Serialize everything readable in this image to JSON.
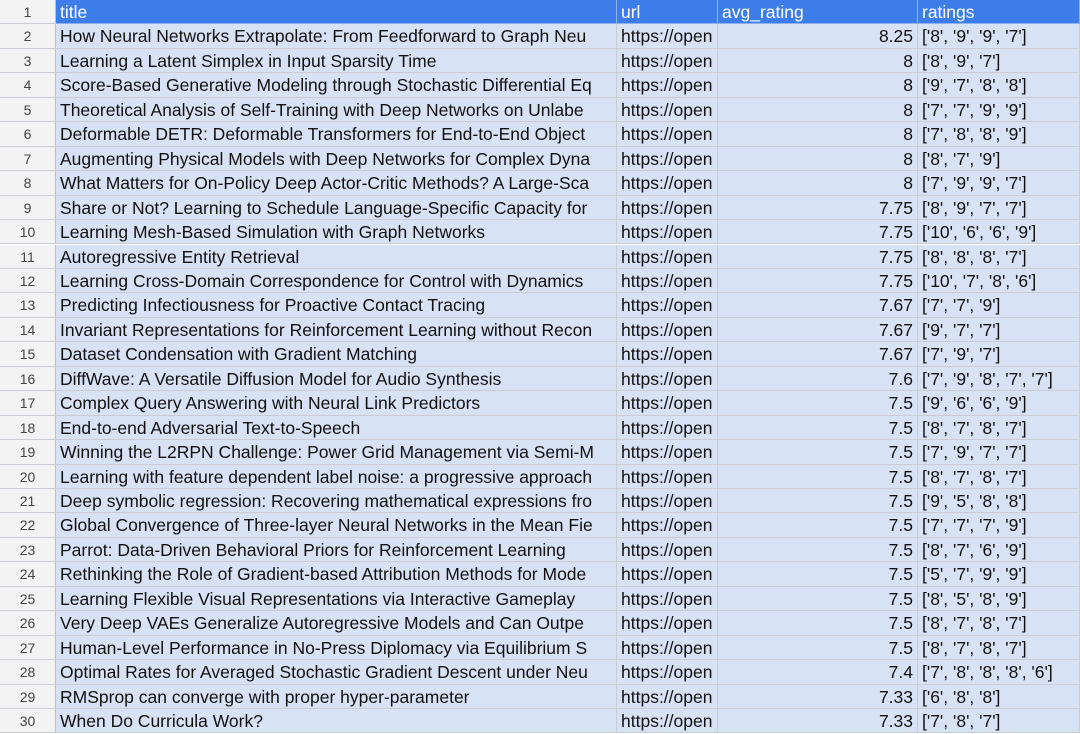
{
  "header": {
    "row_number": "1",
    "columns": [
      "title",
      "url",
      "avg_rating",
      "ratings"
    ]
  },
  "rows": [
    {
      "n": "2",
      "title": "How Neural Networks Extrapolate: From Feedforward to Graph Neu",
      "url": "https://open",
      "avg_rating": "8.25",
      "ratings": "['8', '9', '9', '7']"
    },
    {
      "n": "3",
      "title": "Learning a Latent Simplex in Input Sparsity Time",
      "url": "https://open",
      "avg_rating": "8",
      "ratings": "['8', '9', '7']"
    },
    {
      "n": "4",
      "title": "Score-Based Generative Modeling through Stochastic Differential Eq",
      "url": "https://open",
      "avg_rating": "8",
      "ratings": "['9', '7', '8', '8']"
    },
    {
      "n": "5",
      "title": "Theoretical Analysis of Self-Training with Deep Networks on Unlabe",
      "url": "https://open",
      "avg_rating": "8",
      "ratings": "['7', '7', '9', '9']"
    },
    {
      "n": "6",
      "title": "Deformable DETR: Deformable Transformers for End-to-End Object",
      "url": "https://open",
      "avg_rating": "8",
      "ratings": "['7', '8', '8', '9']"
    },
    {
      "n": "7",
      "title": "Augmenting Physical Models with Deep Networks for Complex Dyna",
      "url": "https://open",
      "avg_rating": "8",
      "ratings": "['8', '7', '9']"
    },
    {
      "n": "8",
      "title": "What Matters for On-Policy Deep Actor-Critic Methods? A Large-Sca",
      "url": "https://open",
      "avg_rating": "8",
      "ratings": "['7', '9', '9', '7']"
    },
    {
      "n": "9",
      "title": "Share or Not? Learning to Schedule Language-Specific Capacity for",
      "url": "https://open",
      "avg_rating": "7.75",
      "ratings": "['8', '9', '7', '7']"
    },
    {
      "n": "10",
      "title": "Learning Mesh-Based Simulation with Graph Networks",
      "url": "https://open",
      "avg_rating": "7.75",
      "ratings": "['10', '6', '6', '9']"
    },
    {
      "n": "11",
      "title": "Autoregressive Entity Retrieval",
      "url": "https://open",
      "avg_rating": "7.75",
      "ratings": "['8', '8', '8', '7']"
    },
    {
      "n": "12",
      "title": "Learning Cross-Domain Correspondence for Control with Dynamics",
      "url": "https://open",
      "avg_rating": "7.75",
      "ratings": "['10', '7', '8', '6']"
    },
    {
      "n": "13",
      "title": "Predicting Infectiousness for Proactive Contact Tracing",
      "url": "https://open",
      "avg_rating": "7.67",
      "ratings": "['7', '7', '9']"
    },
    {
      "n": "14",
      "title": "Invariant Representations for Reinforcement Learning without Recon",
      "url": "https://open",
      "avg_rating": "7.67",
      "ratings": "['9', '7', '7']"
    },
    {
      "n": "15",
      "title": "Dataset Condensation with Gradient Matching",
      "url": "https://open",
      "avg_rating": "7.67",
      "ratings": "['7', '9', '7']"
    },
    {
      "n": "16",
      "title": "DiffWave: A Versatile Diffusion Model for Audio Synthesis",
      "url": "https://open",
      "avg_rating": "7.6",
      "ratings": "['7', '9', '8', '7', '7']"
    },
    {
      "n": "17",
      "title": "Complex Query Answering with Neural Link Predictors",
      "url": "https://open",
      "avg_rating": "7.5",
      "ratings": "['9', '6', '6', '9']"
    },
    {
      "n": "18",
      "title": "End-to-end Adversarial Text-to-Speech",
      "url": "https://open",
      "avg_rating": "7.5",
      "ratings": "['8', '7', '8', '7']"
    },
    {
      "n": "19",
      "title": "Winning the L2RPN Challenge: Power Grid Management via Semi-M",
      "url": "https://open",
      "avg_rating": "7.5",
      "ratings": "['7', '9', '7', '7']"
    },
    {
      "n": "20",
      "title": "Learning with feature dependent label noise: a progressive approach",
      "url": "https://open",
      "avg_rating": "7.5",
      "ratings": "['8', '7', '8', '7']"
    },
    {
      "n": "21",
      "title": "Deep symbolic regression: Recovering mathematical expressions fro",
      "url": "https://open",
      "avg_rating": "7.5",
      "ratings": "['9', '5', '8', '8']"
    },
    {
      "n": "22",
      "title": "Global Convergence of Three-layer Neural Networks in the Mean Fie",
      "url": "https://open",
      "avg_rating": "7.5",
      "ratings": "['7', '7', '7', '9']"
    },
    {
      "n": "23",
      "title": "Parrot: Data-Driven Behavioral Priors for Reinforcement Learning",
      "url": "https://open",
      "avg_rating": "7.5",
      "ratings": "['8', '7', '6', '9']"
    },
    {
      "n": "24",
      "title": "Rethinking the Role of Gradient-based Attribution Methods for Mode",
      "url": "https://open",
      "avg_rating": "7.5",
      "ratings": "['5', '7', '9', '9']"
    },
    {
      "n": "25",
      "title": "Learning Flexible Visual Representations via Interactive Gameplay",
      "url": "https://open",
      "avg_rating": "7.5",
      "ratings": "['8', '5', '8', '9']"
    },
    {
      "n": "26",
      "title": "Very Deep VAEs Generalize Autoregressive Models and Can Outpe",
      "url": "https://open",
      "avg_rating": "7.5",
      "ratings": "['8', '7', '8', '7']"
    },
    {
      "n": "27",
      "title": "Human-Level Performance in No-Press Diplomacy via Equilibrium S",
      "url": "https://open",
      "avg_rating": "7.5",
      "ratings": "['8', '7', '8', '7']"
    },
    {
      "n": "28",
      "title": "Optimal Rates for Averaged Stochastic Gradient Descent under Neu",
      "url": "https://open",
      "avg_rating": "7.4",
      "ratings": "['7', '8', '8', '8', '6']"
    },
    {
      "n": "29",
      "title": "RMSprop can converge with proper hyper-parameter",
      "url": "https://open",
      "avg_rating": "7.33",
      "ratings": "['6', '8', '8']"
    },
    {
      "n": "30",
      "title": "When Do Curricula Work?",
      "url": "https://open",
      "avg_rating": "7.33",
      "ratings": "['7', '8', '7']"
    }
  ]
}
